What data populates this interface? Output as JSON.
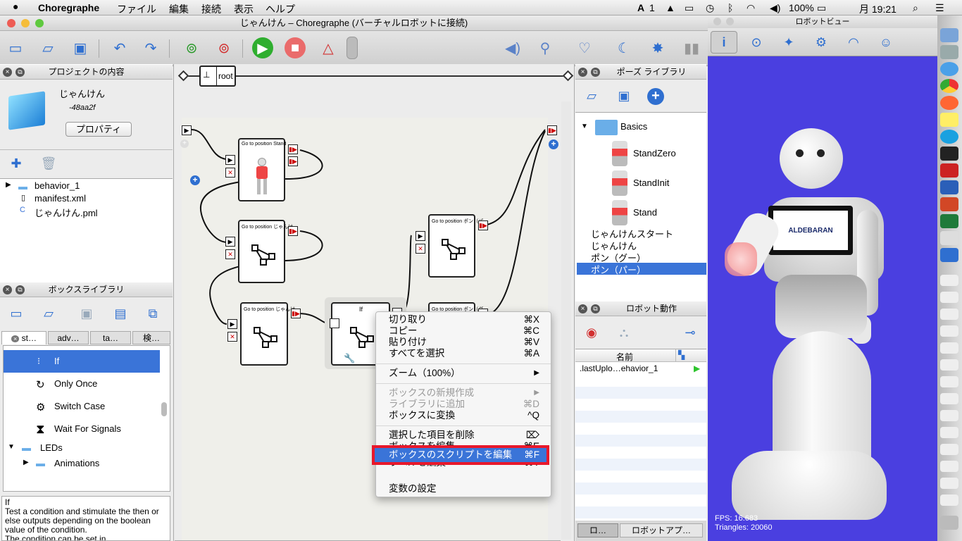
{
  "menubar": {
    "app": "Choregraphe",
    "items": [
      "ファイル",
      "編集",
      "接続",
      "表示",
      "ヘルプ"
    ],
    "input": "1",
    "battery": "100%",
    "clock": "月 19:21"
  },
  "window": {
    "title": "じゃんけん – Choregraphe (バーチャルロボットに接続)"
  },
  "project": {
    "header": "プロジェクトの内容",
    "name": "じゃんけん",
    "id": "-48aa2f",
    "properties": "プロパティ",
    "files": [
      "behavior_1",
      "manifest.xml",
      "じゃんけん.pml"
    ]
  },
  "boxlib": {
    "header": "ボックスライブラリ",
    "tabs": [
      "st…",
      "adv…",
      "ta…",
      "検…"
    ],
    "items": [
      "If",
      "Only Once",
      "Switch Case",
      "Wait For Signals",
      "LEDs",
      "Animations"
    ],
    "desc": "If\nTest a condition and stimulate the then or else outputs depending on the boolean value of the condition.\nThe condition can be set in"
  },
  "flow": {
    "root": "root",
    "boxes": [
      "Go to position Stand",
      "Go to position じゃんけ…",
      "Go to position じゃんけ…",
      "If",
      "Go to position ポン（パ…",
      "Go to position ポン（グ…"
    ]
  },
  "ctx": {
    "items": [
      {
        "label": "切り取り",
        "key": "⌘X"
      },
      {
        "label": "コピー",
        "key": "⌘C"
      },
      {
        "label": "貼り付け",
        "key": "⌘V"
      },
      {
        "label": "すべてを選択",
        "key": "⌘A"
      },
      {
        "label": "ズーム（100%）",
        "key": "▶"
      },
      {
        "label": "ボックスの新規作成",
        "key": "▶"
      },
      {
        "label": "ライブラリに追加",
        "key": "⌘D"
      },
      {
        "label": "ボックスに変換",
        "key": "^Q"
      },
      {
        "label": "選択した項目を削除",
        "key": "⌦"
      },
      {
        "label": "ボックスを編集",
        "key": "⌘E"
      },
      {
        "label": "ボックスのスクリプトを編集",
        "key": "⌘F"
      },
      {
        "label": "ラベルを編集",
        "key": "⌘T"
      },
      {
        "label": "変数の設定",
        "key": ""
      }
    ]
  },
  "poselib": {
    "header": "ポーズ ライブラリ",
    "folder": "Basics",
    "poses": [
      "StandZero",
      "StandInit",
      "Stand"
    ],
    "list": [
      "じゃんけんスタート",
      "じゃんけん",
      "ポン（グー）",
      "ポン（パー）"
    ]
  },
  "motion": {
    "header": "ロボット動作",
    "col": "名前",
    "row": ".lastUplo…ehavior_1",
    "tabs": [
      "ロ…",
      "ロボットアプ…"
    ]
  },
  "robotview": {
    "header": "ロボットビュー",
    "logo": "ALDEBARAN",
    "fps": "FPS: 16.683",
    "tris": "Triangles: 20060"
  },
  "colors": {
    "highlight": "#3a74d8",
    "robotbg": "#4a3fe0",
    "redbox": "#e8182b"
  }
}
